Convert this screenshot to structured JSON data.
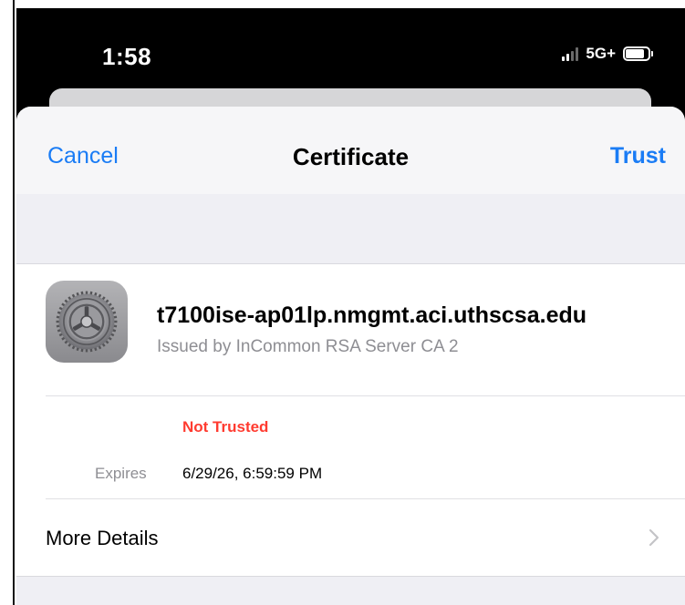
{
  "status_bar": {
    "time": "1:58",
    "network": "5G+",
    "signal_bars_active": 2,
    "signal_bars_total": 4
  },
  "nav": {
    "cancel_label": "Cancel",
    "title": "Certificate",
    "trust_label": "Trust"
  },
  "certificate": {
    "icon": "settings-gear-icon",
    "name": "t7100ise-ap01lp.nmgmt.aci.uthscsa.edu",
    "issuer": "Issued by InCommon RSA Server CA 2",
    "status": "Not Trusted",
    "expires_label": "Expires",
    "expires_value": "6/29/26, 6:59:59 PM"
  },
  "more_details": {
    "label": "More Details"
  },
  "colors": {
    "link": "#1a7cf5",
    "danger": "#ff3b30",
    "secondary_text": "#8e8e93",
    "grouped_background": "#efeff4"
  }
}
